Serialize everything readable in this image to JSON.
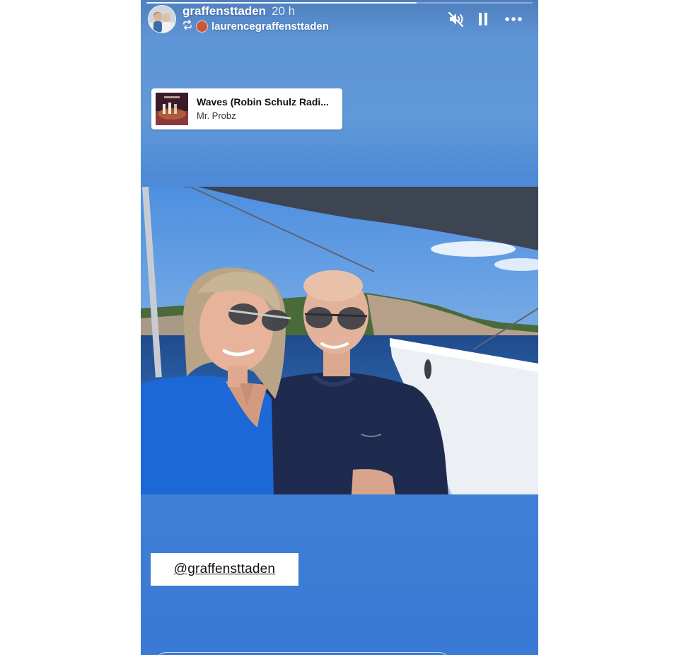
{
  "story": {
    "progress": 0.7,
    "user": {
      "username": "graffensttaden",
      "time": "20 h",
      "avatar": "profile-photo"
    },
    "repost": {
      "icon": "repost-icon",
      "username": "laurencegraffensttaden"
    },
    "controls": {
      "mute_icon": "speaker-muted-icon",
      "pause_icon": "pause-icon",
      "more_icon": "more-horizontal-icon"
    },
    "music": {
      "title": "Waves (Robin Schulz Radi...",
      "artist": "Mr. Probz",
      "cover_icon": "album-cover"
    },
    "photo": {
      "subject": "couple-selfie-on-sailboat"
    },
    "mention": {
      "text": "@graffensttaden"
    }
  },
  "colors": {
    "story_top": "#4f7fbe",
    "story_mid": "#6098d8",
    "story_bottom": "#3a79d4",
    "sticker_bg": "#ffffff",
    "text_dark": "#111111"
  }
}
